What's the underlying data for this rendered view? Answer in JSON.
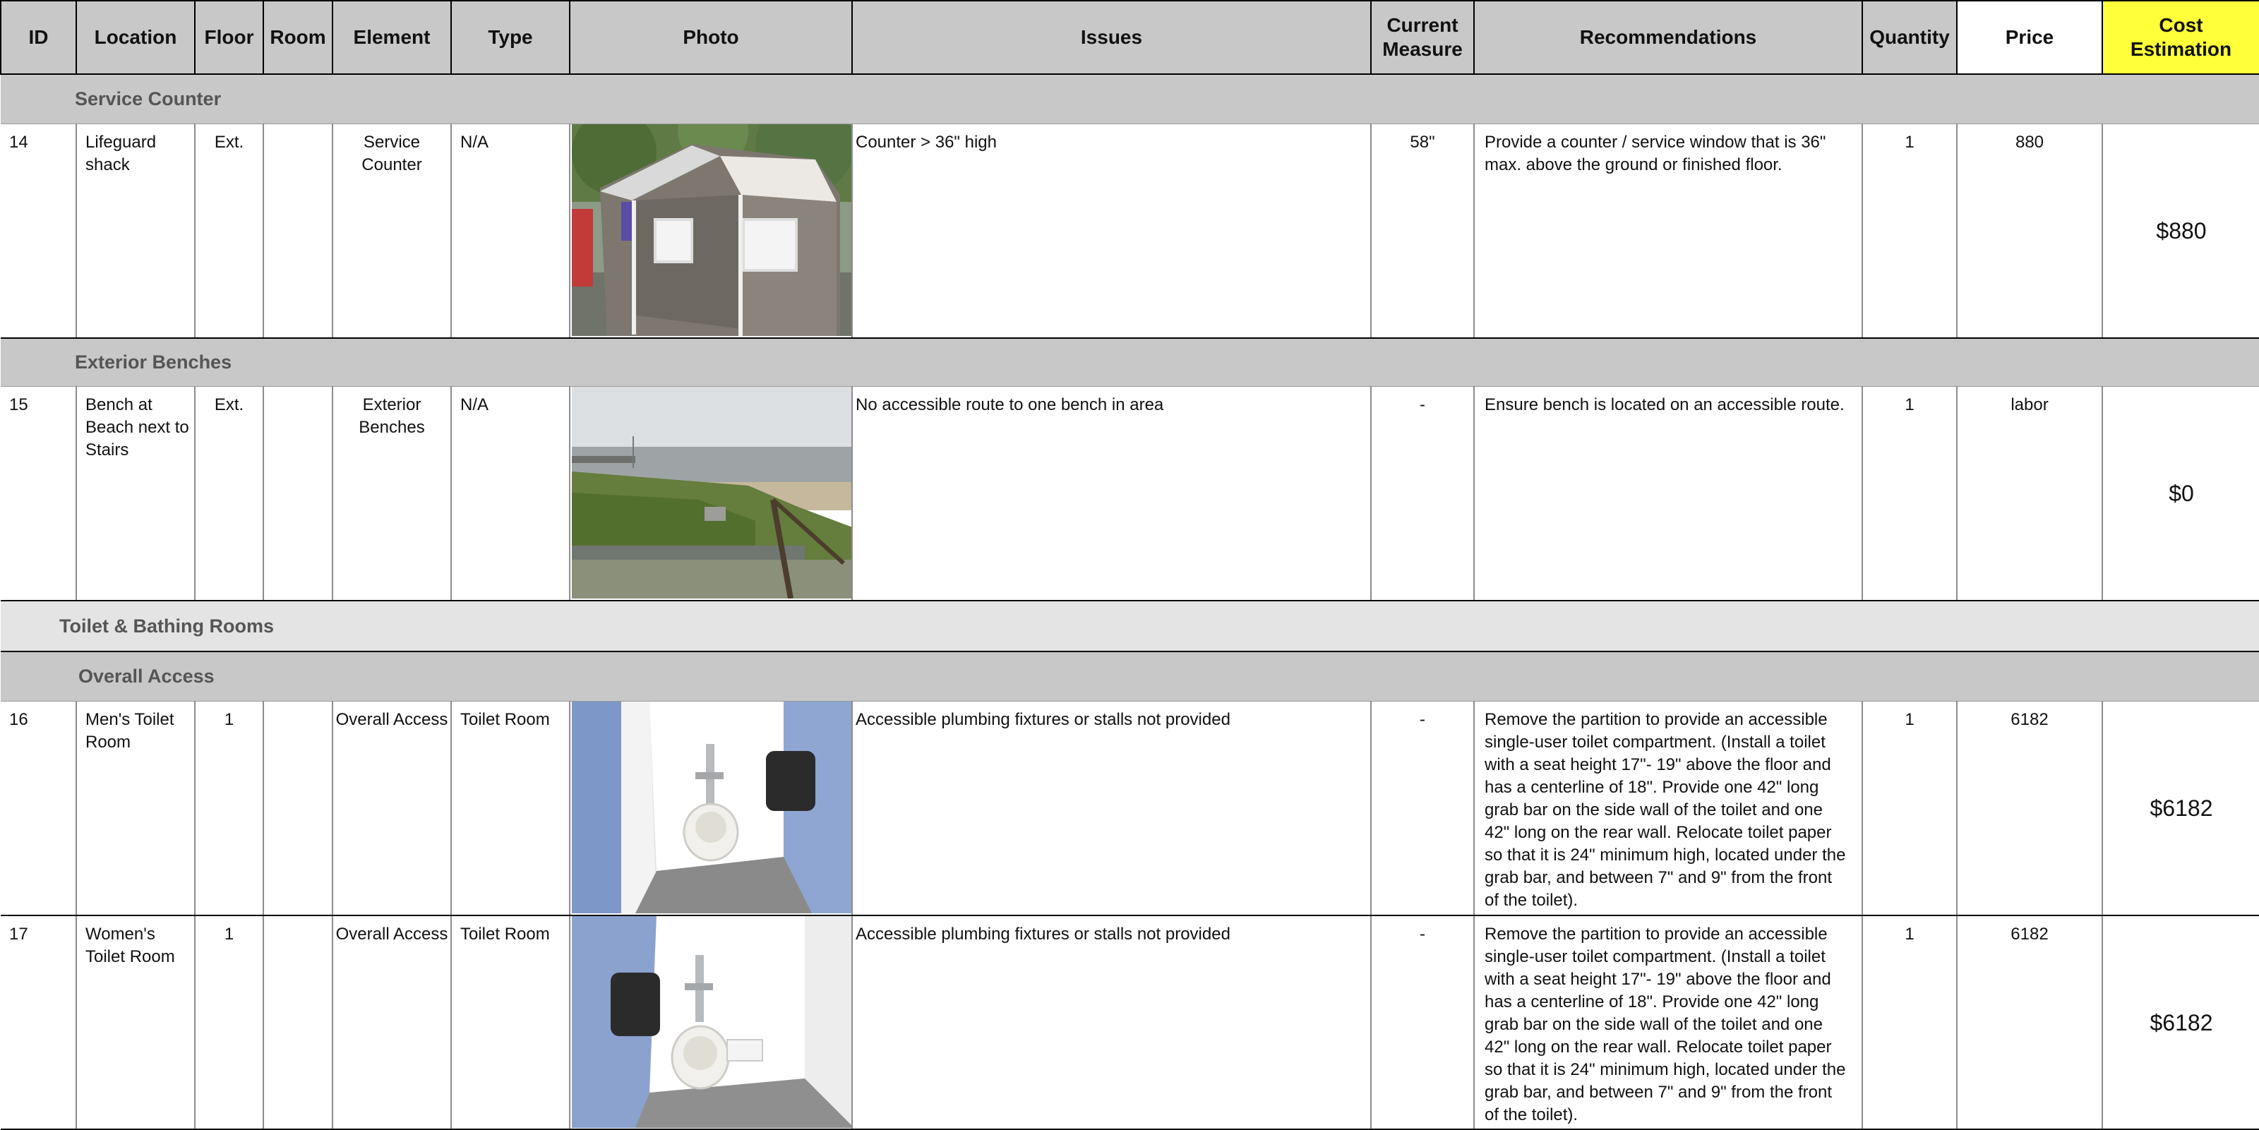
{
  "headers": {
    "id": "ID",
    "location": "Location",
    "floor": "Floor",
    "room": "Room",
    "element": "Element",
    "type": "Type",
    "photo": "Photo",
    "issues": "Issues",
    "current_measure": "Current Measure",
    "recommendations": "Recommendations",
    "quantity": "Quantity",
    "price": "Price",
    "cost_estimation": "Cost Estimation"
  },
  "sections": {
    "service_counter": "Service Counter",
    "exterior_benches": "Exterior Benches",
    "toilet_bathing": "Toilet & Bathing Rooms",
    "overall_access": "Overall Access"
  },
  "rows": [
    {
      "id": "14",
      "location": "Lifeguard shack",
      "floor": "Ext.",
      "room": "",
      "element": "Service Counter",
      "type": "N/A",
      "photo_icon": "lifeguard-shack-photo",
      "issue": "Counter > 36\" high",
      "measure": "58\"",
      "recommendation": "Provide a counter / service window that is 36\" max. above the ground or finished floor.",
      "quantity": "1",
      "price": "880",
      "cost": "$880"
    },
    {
      "id": "15",
      "location": "Bench at Beach next to Stairs",
      "floor": "Ext.",
      "room": "",
      "element": "Exterior Benches",
      "type": "N/A",
      "photo_icon": "beach-bench-photo",
      "issue": "No accessible route to one bench in area",
      "measure": "-",
      "recommendation": "Ensure  bench is located on an accessible route.",
      "quantity": "1",
      "price": "labor",
      "cost": "$0"
    },
    {
      "id": "16",
      "location": "Men's Toilet Room",
      "floor": "1",
      "room": "",
      "element": "Overall Access",
      "type": "Toilet Room",
      "photo_icon": "mens-toilet-photo",
      "issue": "Accessible plumbing fixtures or stalls not provided",
      "measure": "-",
      "recommendation": "Remove the partition to provide an accessible single-user toilet compartment. (Install a toilet with a seat height 17\"- 19\" above the floor and has a centerline of 18\". Provide one 42\" long grab bar on the side wall of the toilet and one 42\" long on the rear wall. Relocate toilet paper so that it is 24\" minimum high, located under the grab bar, and between 7\" and 9\" from the front of the toilet).",
      "quantity": "1",
      "price": "6182",
      "cost": "$6182"
    },
    {
      "id": "17",
      "location": "Women's Toilet Room",
      "floor": "1",
      "room": "",
      "element": "Overall Access",
      "type": "Toilet Room",
      "photo_icon": "womens-toilet-photo",
      "issue": "Accessible plumbing fixtures or stalls not provided",
      "measure": "-",
      "recommendation": "Remove the partition to provide an accessible single-user toilet compartment. (Install a toilet with a seat height 17\"- 19\" above the floor and has a centerline of 18\". Provide one 42\" long grab bar on the side wall of the toilet and one 42\" long on the rear wall. Relocate toilet paper so that it is 24\" minimum high, located under the grab bar, and between 7\" and 9\" from the front of the toilet).",
      "quantity": "1",
      "price": "6182",
      "cost": "$6182"
    }
  ],
  "colors": {
    "header_bg": "#c8c8c8",
    "section_bg": "#c8c8c8",
    "group_bg": "#e4e4e4",
    "cost_header_bg": "#ffff3a"
  }
}
